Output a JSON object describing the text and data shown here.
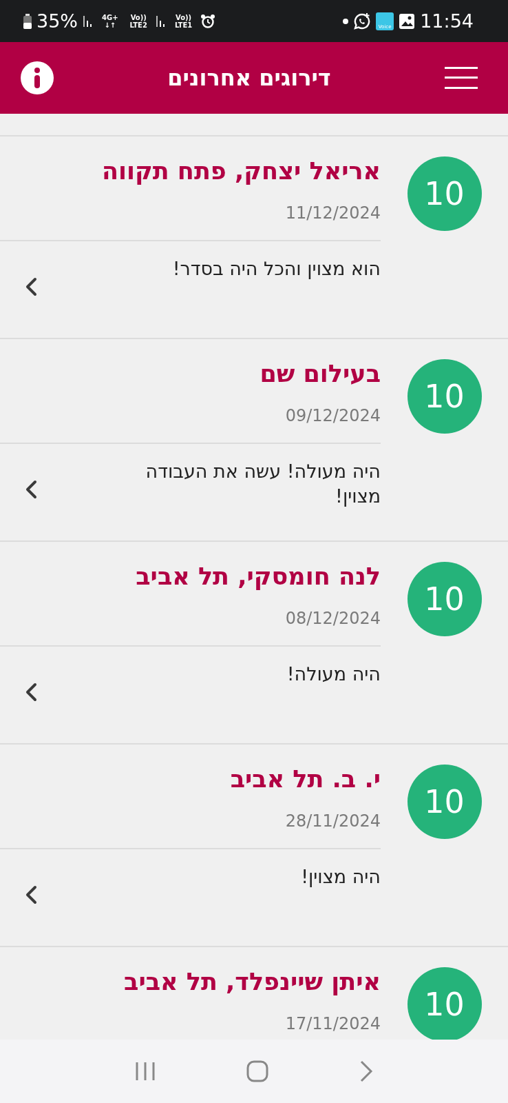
{
  "status_bar": {
    "battery": "35%",
    "left_items": [
      {
        "kind": "alarm"
      },
      {
        "kind": "stack",
        "top": "Vo))",
        "bottom": "LTE1"
      },
      {
        "kind": "signal"
      },
      {
        "kind": "stack",
        "top": "Vo))",
        "bottom": "LTE2"
      },
      {
        "kind": "stack",
        "top": "4G+",
        "bottom": "↓↑"
      },
      {
        "kind": "signal"
      }
    ],
    "voice_app_label": "Voice",
    "time": "11:54"
  },
  "header": {
    "title": "דירוגים אחרונים"
  },
  "reviews": [
    {
      "score": "10",
      "name": "אריאל יצחק, פתח תקווה",
      "date": "11/12/2024",
      "comment": "הוא מצוין והכל היה בסדר!"
    },
    {
      "score": "10",
      "name": "בעילום שם",
      "date": "09/12/2024",
      "comment": "היה מעולה! עשה את העבודה מצוין!"
    },
    {
      "score": "10",
      "name": "לנה חומסקי, תל אביב",
      "date": "08/12/2024",
      "comment": "היה מעולה!"
    },
    {
      "score": "10",
      "name": "י. ב. תל אביב",
      "date": "28/11/2024",
      "comment": "היה מצוין!"
    },
    {
      "score": "10",
      "name": "איתן שיינפלד, תל אביב",
      "date": "17/11/2024"
    }
  ]
}
